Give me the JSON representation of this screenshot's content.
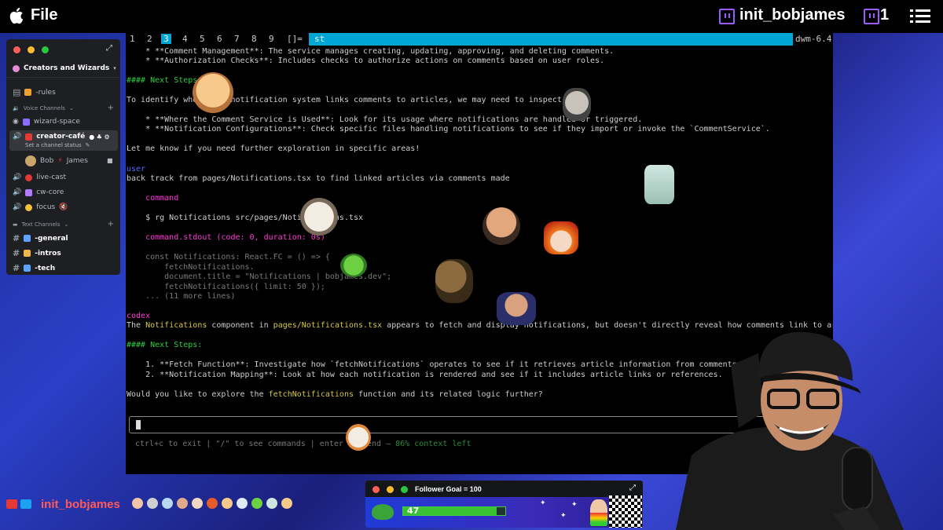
{
  "topbar": {
    "menu": "File",
    "username": "init_bobjames",
    "viewer_count": "1"
  },
  "discord": {
    "server_name": "Creators and Wizards",
    "rules_channel": "-rules",
    "voice_category": "Voice Channels",
    "voice_channels": [
      "wizard-space",
      "creator-café",
      "live-cast",
      "cw-core",
      "focus"
    ],
    "active_status": "Set a channel status",
    "voice_users": "Bob",
    "voice_users_2": "James",
    "text_category": "Text Channels",
    "text_channels": [
      "-general",
      "-intros",
      "-tech"
    ]
  },
  "terminal": {
    "tags": [
      "1",
      "2",
      "3",
      "4",
      "5",
      "6",
      "7",
      "8",
      "9",
      "[]="
    ],
    "window_title": "st",
    "wm_version": "dwm-6.4",
    "lines": {
      "l1": "    * **Comment Management**: The service manages creating, updating, approving, and deleting comments.",
      "l2": "    * **Authorization Checks**: Includes checks to authorize actions on comments based on user roles.",
      "l3": "#### Next Steps:",
      "l4": "To identify where the notification system links comments to articles, we may need to inspect:",
      "l5": "    * **Where the Comment Service is Used**: Look for its usage where notifications are handled or triggered.",
      "l6": "    * **Notification Configurations**: Check specific files handling notifications to see if they import or invoke the `CommentService`.",
      "l7": "Let me know if you need further exploration in specific areas!",
      "l8": "user",
      "l9": "back track from pages/Notifications.tsx to find linked articles via comments made",
      "l10": "    command",
      "l11": "    $ rg Notifications src/pages/Notifications.tsx",
      "l12": "    command.stdout (code: 0, duration: 0s)",
      "l13": "    const Notifications: React.FC = () => {",
      "l14": "        fetchNotifications.",
      "l15": "        document.title = \"Notifications | bobjames.dev\";",
      "l16": "        fetchNotifications({ limit: 50 });",
      "l17": "    ... (11 more lines)",
      "l18": "codex",
      "l19a": "The ",
      "l19b": "Notifications",
      "l19c": " component in ",
      "l19d": "pages/Notifications.tsx",
      "l19e": " appears to fetch and display notifications, but doesn't directly reveal how comments link to articles.",
      "l20": "#### Next Steps:",
      "l21": "    1. **Fetch Function**: Investigate how `fetchNotifications` operates to see if it retrieves article information from comments.",
      "l22": "    2. **Notification Mapping**: Look at how each notification is rendered and see if it includes article links or references.",
      "l23a": "Would you like to explore the ",
      "l23b": "fetchNotifications",
      "l23c": " function and its related logic further?"
    },
    "hint": "ctrl+c to exit | \"/\" to see commands | enter to send",
    "context": "86% context left"
  },
  "bottom": {
    "username": "init_bobjames"
  },
  "follower_goal": {
    "title": "Follower Goal = 100",
    "current": "47",
    "current_value": 47,
    "target": 100
  },
  "colors": {
    "accent_cyan": "#00a6d6",
    "twitch_purple": "#9b59ff",
    "terminal_green": "#2ecc40",
    "user_red": "#ff5a5a"
  }
}
